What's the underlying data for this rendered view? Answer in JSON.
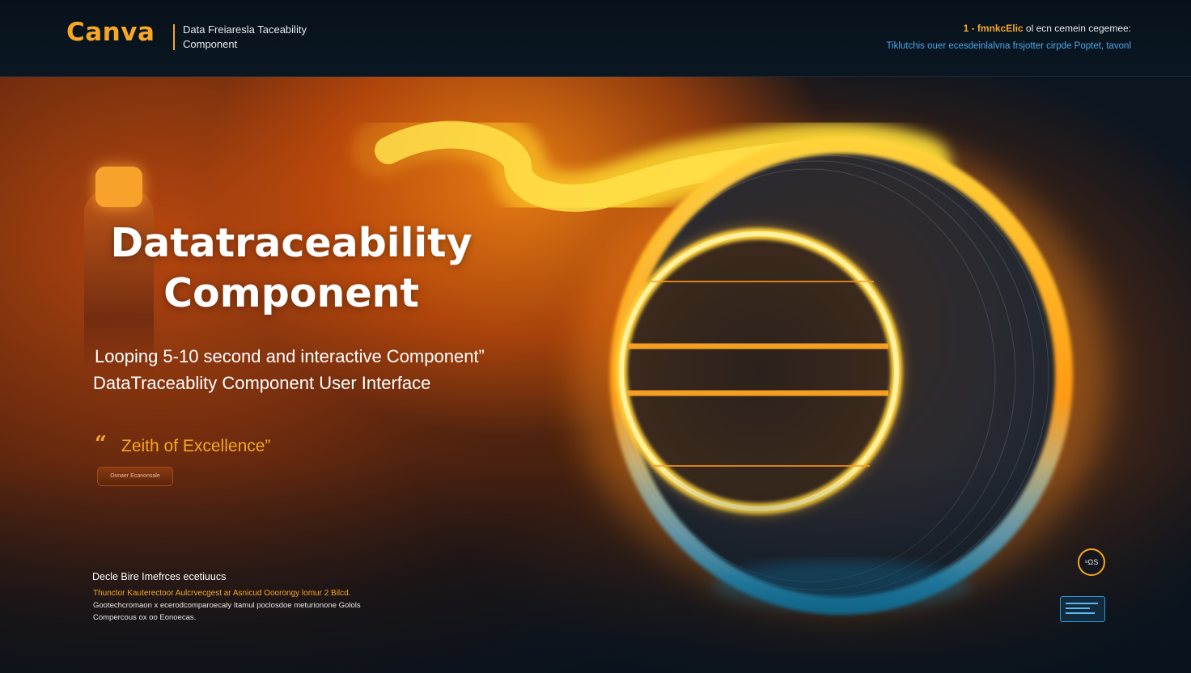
{
  "header": {
    "logo": "Canva",
    "title": "Data Freiaresla Taceability Component",
    "right_accent": "1 - fmnkcElic",
    "right_rest": " ol ecn cemein cegemee:",
    "right_line2": "Tiklutchis ouer ecesdeinlalvna frsjotter cirpde Poptet, tavonl"
  },
  "hero": {
    "title": "Datatraceability Component",
    "subtitle_1": "Looping 5-10 second and interactive Component”",
    "subtitle_2": "DataTraceablity Component  User Interface",
    "quote_mark": "“",
    "quote_text": "Zeith of Excellence”",
    "pill_label": "Ovnaer Ecanonsale"
  },
  "footer": {
    "heading": "Decle Bire Imefrces ecetiuucs",
    "line_1": "Thunctor Kauterectoor Aulcrvecgest ar Asnicud Ooorongy lomur 2 Bilcd.",
    "line_2": "Gootechcromaon x ecerodcomparoecaly Itamul poclosdoe meturionone Golols",
    "line_3": "Compercous ox oo Eonoecas."
  },
  "widgets": {
    "circle_badge": "⁹ΩS"
  },
  "colors": {
    "accent": "#f6a723",
    "link_blue": "#4aa8e8",
    "background": "#0b1420"
  }
}
